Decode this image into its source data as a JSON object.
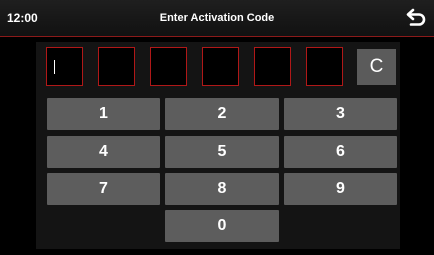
{
  "status_bar": {
    "time": "12:00",
    "title": "Enter Activation Code",
    "back_icon": "back-arrow-icon"
  },
  "code_entry": {
    "digit_count": 6,
    "active_slot": 1,
    "entered": [
      "",
      "",
      "",
      "",
      "",
      ""
    ],
    "clear_label": "C"
  },
  "keypad": {
    "keys": [
      "1",
      "2",
      "3",
      "4",
      "5",
      "6",
      "7",
      "8",
      "9",
      "0"
    ]
  },
  "colors": {
    "background": "#000000",
    "accent_red": "#b01818",
    "key_gray": "#5d5d5d"
  }
}
